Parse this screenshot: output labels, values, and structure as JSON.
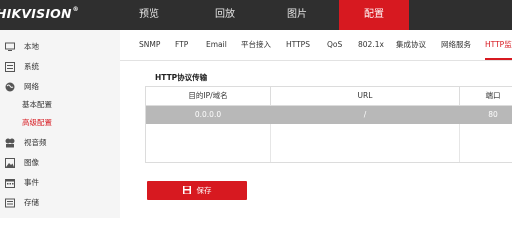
{
  "header": {
    "logo_text": "HIKVISION",
    "nav": [
      "预览",
      "回放",
      "图片",
      "配置"
    ],
    "active_nav": "配置"
  },
  "sidebar": {
    "items": [
      {
        "label": "本地",
        "icon": "monitor-icon"
      },
      {
        "label": "系统",
        "icon": "system-icon"
      },
      {
        "label": "网络",
        "icon": "globe-icon"
      },
      {
        "label": "视音频",
        "icon": "video-audio-icon"
      },
      {
        "label": "图像",
        "icon": "image-icon"
      },
      {
        "label": "事件",
        "icon": "calendar-icon"
      },
      {
        "label": "存储",
        "icon": "storage-icon"
      }
    ],
    "sub_items": [
      "基本配置",
      "高级配置"
    ],
    "active_sub": "高级配置"
  },
  "tabs": [
    "SNMP",
    "FTP",
    "Email",
    "平台接入",
    "HTTPS",
    "QoS",
    "802.1x",
    "集成协议",
    "网络服务",
    "HTTP监"
  ],
  "active_tab": "HTTP监",
  "section": {
    "title": "HTTP协议传输",
    "columns": [
      "目的IP/域名",
      "URL",
      "端口"
    ],
    "rows": [
      {
        "ip": "0.0.0.0",
        "url": "/",
        "port": "80"
      }
    ]
  },
  "save_label": "保存",
  "colors": {
    "accent": "#d71920",
    "topbar": "#2f2f2f",
    "row_selected": "#b8b8b8"
  }
}
